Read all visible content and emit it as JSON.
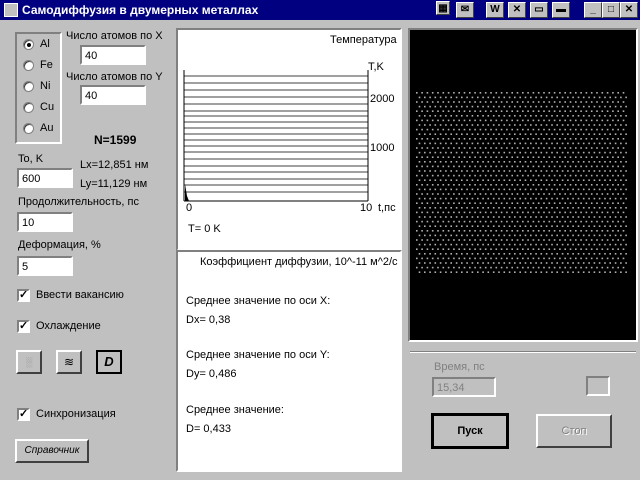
{
  "window": {
    "title": "Самодиффузия в двумерных металлах"
  },
  "metals": [
    {
      "label": "Al",
      "selected": true
    },
    {
      "label": "Fe",
      "selected": false
    },
    {
      "label": "Ni",
      "selected": false
    },
    {
      "label": "Cu",
      "selected": false
    },
    {
      "label": "Au",
      "selected": false
    }
  ],
  "atoms_x": {
    "label": "Число атомов по X",
    "value": "40"
  },
  "atoms_y": {
    "label": "Число атомов по Y",
    "value": "40"
  },
  "n_total": "N=1599",
  "lx": "Lx=12,851 нм",
  "ly": "Ly=11,129 нм",
  "temp0": {
    "label": "To, K",
    "value": "600"
  },
  "duration": {
    "label": "Продолжительность, пс",
    "value": "10"
  },
  "deformation": {
    "label": "Деформация, %",
    "value": "5"
  },
  "checks": {
    "vacancy": "Ввести вакансию",
    "cooling": "Охлаждение",
    "sync": "Синхронизация"
  },
  "tool_buttons": {
    "d_label": "D"
  },
  "help_button": "Справочник",
  "temp_chart": {
    "title": "Температура",
    "ylabel": "T,K",
    "xlabel": "t,пс",
    "tick_2000": "2000",
    "tick_1000": "1000",
    "tick_x0": "0",
    "tick_x10": "10",
    "readout": "T= 0 K"
  },
  "diffusion": {
    "header": "Коэффициент диффузии, 10^-11 м^2/с",
    "x_label": "Среднее значение по оси X:",
    "x_value": "Dx= 0,38",
    "y_label": "Среднее значение по оси Y:",
    "y_value": "Dy= 0,486",
    "avg_label": "Среднее значение:",
    "avg_value": "D=  0,433"
  },
  "time": {
    "label": "Время, пс",
    "value": "15,34"
  },
  "start_button": "Пуск",
  "stop_button": "Стоп",
  "colors": {
    "titlebar": "#000080",
    "face": "#c0c0c0",
    "sim_bg": "#000000",
    "atoms": "#b0b0b0"
  }
}
